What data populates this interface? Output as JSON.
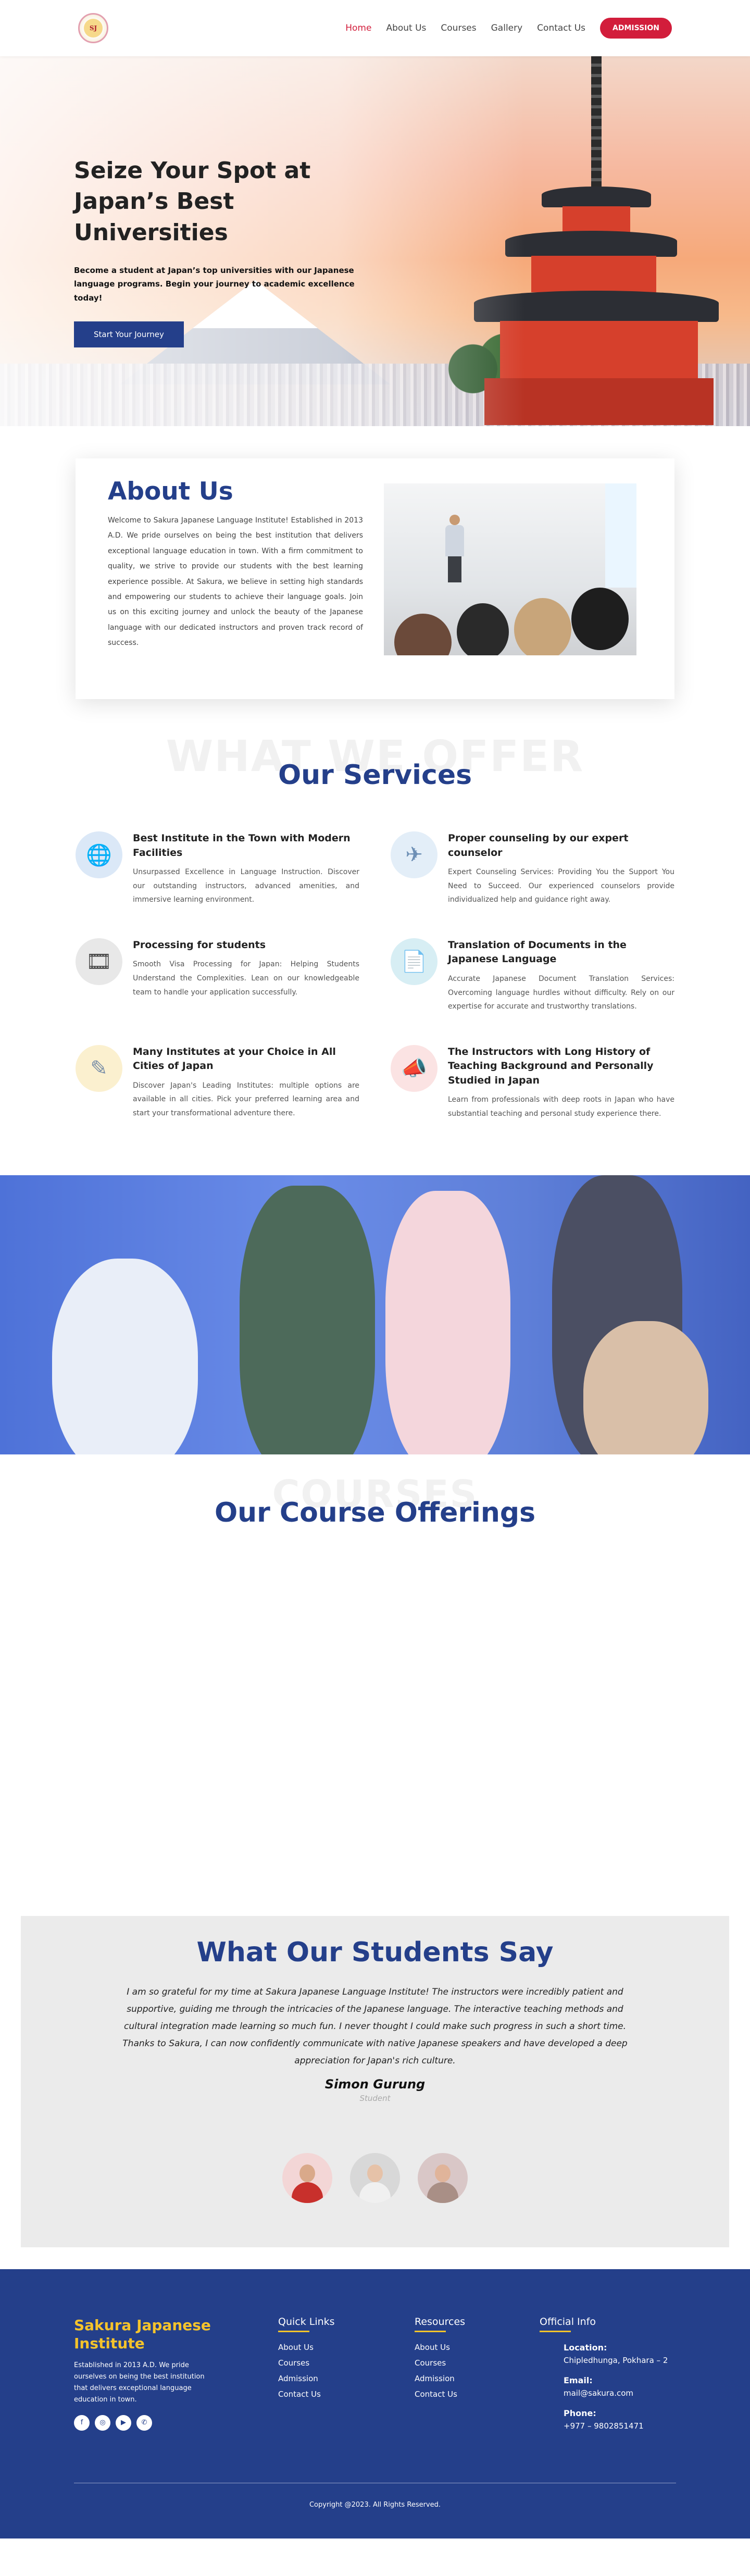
{
  "nav": {
    "logo_text": "SJ",
    "links": [
      "Home",
      "About Us",
      "Courses",
      "Gallery",
      "Contact Us"
    ],
    "admission_label": "ADMISSION"
  },
  "hero": {
    "title": "Seize Your Spot at Japan’s Best Universities",
    "subtitle": "Become a student at Japan’s top universities with our Japanese language programs. Begin your journey to academic excellence today!",
    "button_label": "Start Your Journey"
  },
  "about": {
    "title": "About Us",
    "body": "Welcome to Sakura Japanese Language Institute! Established in 2013 A.D. We pride ourselves on being the best institution that delivers exceptional language education in town. With a firm commitment to quality, we strive to provide our students with the best learning experience possible. At Sakura, we believe in setting high standards and empowering our students to achieve their language goals. Join us on this exciting journey and unlock the beauty of the Japanese language with our dedicated instructors and proven track record of success."
  },
  "services": {
    "ghost_title": "WHAT WE OFFER",
    "title": "Our Services",
    "items": [
      {
        "title": "Best Institute in the Town with Modern Facilities",
        "desc": "Unsurpassed Excellence in Language Instruction. Discover our outstanding instructors, advanced amenities, and immersive learning environment.",
        "icon": "globe-icon",
        "glyph": "🌐"
      },
      {
        "title": "Proper counseling by our expert counselor",
        "desc": "Expert Counseling Services: Providing You the Support You Need to Succeed. Our experienced counselors provide individualized help and guidance right away.",
        "icon": "airplane-icon",
        "glyph": "✈"
      },
      {
        "title": "Processing for students",
        "desc": "Smooth Visa Processing for Japan: Helping Students Understand the Complexities. Lean on our knowledgeable team to handle your application successfully.",
        "icon": "film-reel-icon",
        "glyph": "🎞"
      },
      {
        "title": "Translation of Documents in the Japanese Language",
        "desc": "Accurate Japanese Document Translation Services: Overcoming language hurdles without difficulty. Rely on our expertise for accurate and trustworthy translations.",
        "icon": "documents-icon",
        "glyph": "📄"
      },
      {
        "title": "Many Institutes at your Choice in All Cities of Japan",
        "desc": "Discover Japan's Leading Institutes: multiple options are available in all cities. Pick your preferred learning area and start your transformational adventure there.",
        "icon": "pen-icon",
        "glyph": "✎"
      },
      {
        "title": "The Instructors with Long History of Teaching Background and Personally Studied in Japan",
        "desc": "Learn from professionals with deep roots in Japan who have substantial teaching and personal study experience there.",
        "icon": "megaphone-icon",
        "glyph": "📣"
      }
    ]
  },
  "courses": {
    "ghost_title": "COURSES",
    "title": "Our Course Offerings"
  },
  "testimonial": {
    "title": "What Our Students Say",
    "quote": "I am so grateful for my time at Sakura Japanese Language Institute! The instructors were incredibly patient and supportive, guiding me through the intricacies of the Japanese language. The interactive teaching methods and cultural integration made learning so much fun. I never thought I could make such progress in such a short time. Thanks to Sakura, I can now confidently communicate with native Japanese speakers and have developed a deep appreciation for Japan's rich culture.",
    "name": "Simon Gurung",
    "role": "Student"
  },
  "footer": {
    "brand_name": "Sakura Japanese Institute",
    "brand_desc": "Established in 2013 A.D. We pride ourselves on being the best institution that delivers exceptional language education in town.",
    "socials": [
      "facebook-icon",
      "instagram-icon",
      "youtube-icon",
      "whatsapp-icon"
    ],
    "social_glyphs": [
      "f",
      "◎",
      "▶",
      "✆"
    ],
    "quick_links_title": "Quick Links",
    "quick_links": [
      "About Us",
      "Courses",
      "Admission",
      "Contact Us"
    ],
    "resources_title": "Resources",
    "resources": [
      "About Us",
      "Courses",
      "Admission",
      "Contact Us"
    ],
    "info_title": "Official Info",
    "location_label": "Location:",
    "location_value": "Chipledhunga, Pokhara – 2",
    "email_label": "Email:",
    "email_value": "mail@sakura.com",
    "phone_label": "Phone:",
    "phone_value": "+977 – 9802851471",
    "copyright": "Copyright @2023. All Rights Reserved."
  }
}
